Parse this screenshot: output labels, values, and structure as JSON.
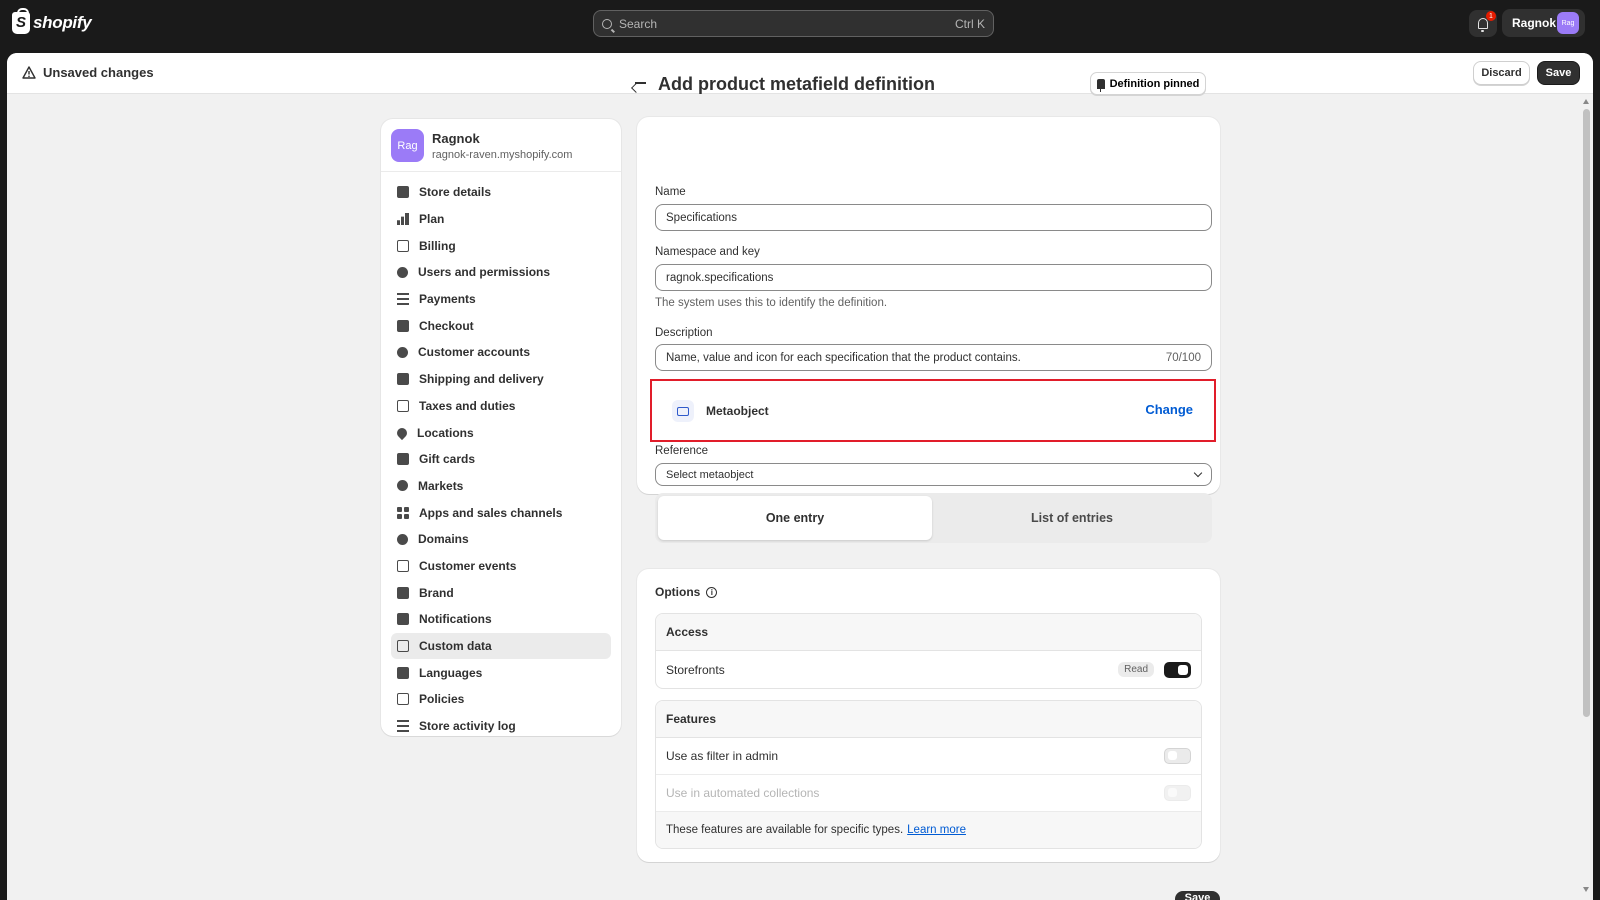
{
  "topbar": {
    "brand": "shopify",
    "search_placeholder": "Search",
    "search_shortcut": "Ctrl K",
    "notification_count": "1",
    "user_name": "Ragnok",
    "user_initials": "Rag"
  },
  "savebar": {
    "title": "Unsaved changes",
    "discard_label": "Discard",
    "save_label": "Save"
  },
  "store": {
    "initials": "Rag",
    "name": "Ragnok",
    "url": "ragnok-raven.myshopify.com"
  },
  "nav": [
    {
      "label": "Store details",
      "icon": "store-icon"
    },
    {
      "label": "Plan",
      "icon": "chart-icon"
    },
    {
      "label": "Billing",
      "icon": "receipt-icon"
    },
    {
      "label": "Users and permissions",
      "icon": "users-icon"
    },
    {
      "label": "Payments",
      "icon": "payments-icon"
    },
    {
      "label": "Checkout",
      "icon": "cart-icon"
    },
    {
      "label": "Customer accounts",
      "icon": "person-icon"
    },
    {
      "label": "Shipping and delivery",
      "icon": "truck-icon"
    },
    {
      "label": "Taxes and duties",
      "icon": "tax-icon"
    },
    {
      "label": "Locations",
      "icon": "location-pin-icon"
    },
    {
      "label": "Gift cards",
      "icon": "gift-card-icon"
    },
    {
      "label": "Markets",
      "icon": "globe-icon"
    },
    {
      "label": "Apps and sales channels",
      "icon": "apps-icon"
    },
    {
      "label": "Domains",
      "icon": "globe-icon"
    },
    {
      "label": "Customer events",
      "icon": "sparkle-icon"
    },
    {
      "label": "Brand",
      "icon": "brand-icon"
    },
    {
      "label": "Notifications",
      "icon": "bell-icon"
    },
    {
      "label": "Custom data",
      "icon": "database-icon",
      "active": true
    },
    {
      "label": "Languages",
      "icon": "language-icon"
    },
    {
      "label": "Policies",
      "icon": "policy-icon"
    },
    {
      "label": "Store activity log",
      "icon": "list-icon"
    }
  ],
  "page": {
    "title": "Add product metafield definition",
    "pinned_label": "Definition pinned"
  },
  "form": {
    "name_label": "Name",
    "name_value": "Specifications",
    "namespace_label": "Namespace and key",
    "namespace_value": "ragnok.specifications",
    "namespace_help": "The system uses this to identify the definition.",
    "description_label": "Description",
    "description_value": "Name, value and icon for each specification that the product contains.",
    "description_count": "70/100",
    "type_label": "Metaobject",
    "change_label": "Change",
    "reference_label": "Reference",
    "reference_value": "Select metaobject",
    "segment_one": "One entry",
    "segment_list": "List of entries"
  },
  "options": {
    "title": "Options",
    "access_title": "Access",
    "storefronts_label": "Storefronts",
    "storefronts_badge": "Read",
    "features_title": "Features",
    "filter_label": "Use as filter in admin",
    "collections_label": "Use in automated collections",
    "features_note": "These features are available for specific types.",
    "learn_more": "Learn more"
  },
  "footer": {
    "save_label": "Save"
  }
}
